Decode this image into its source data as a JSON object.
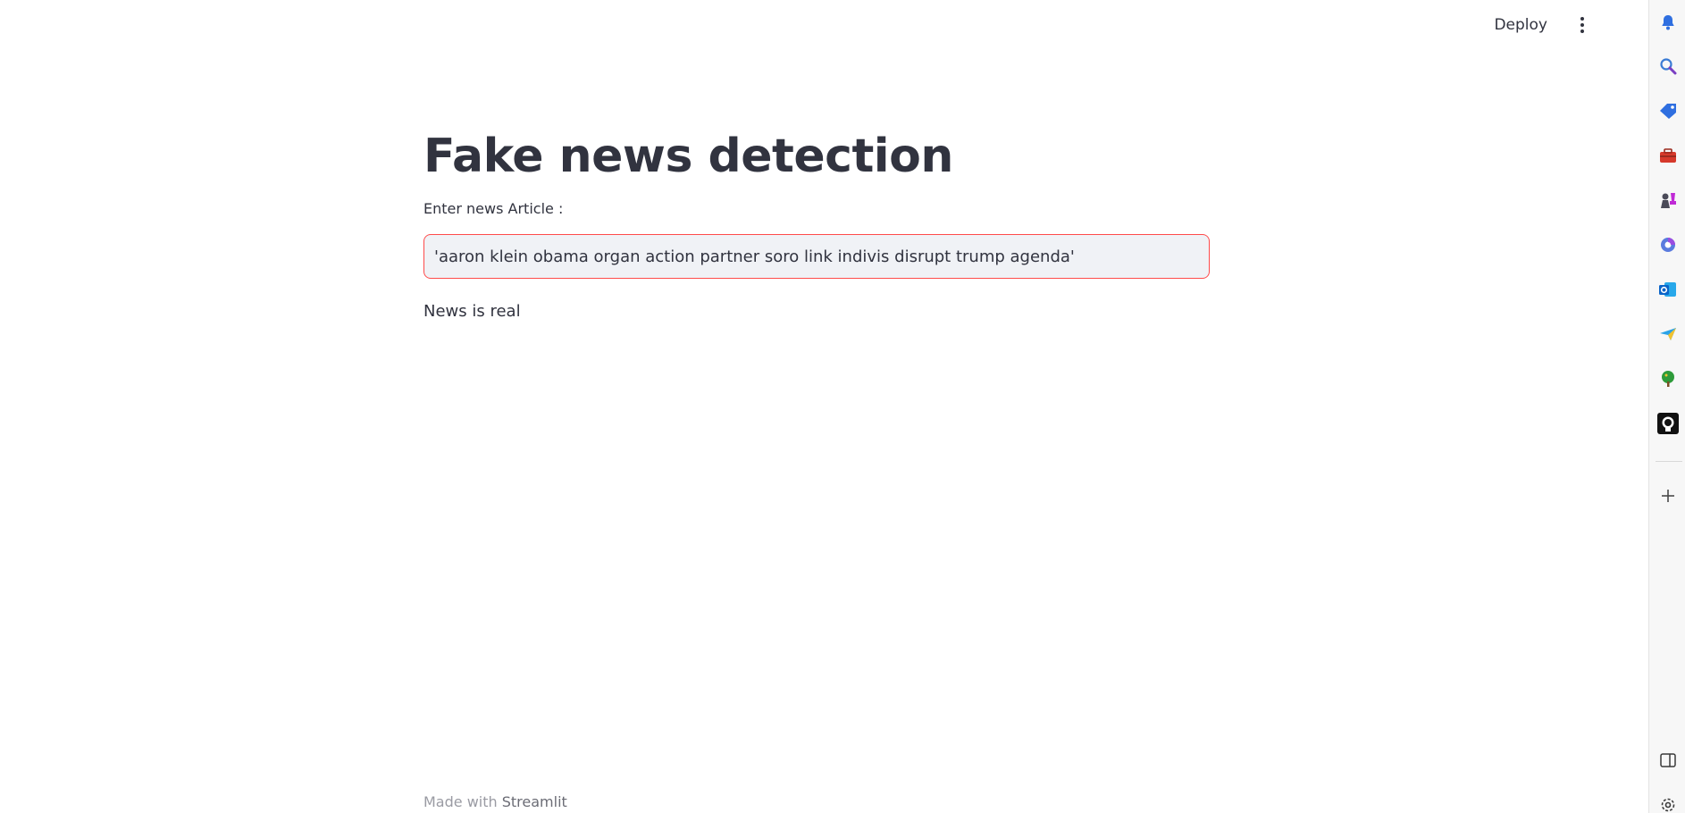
{
  "toolbar": {
    "deploy_label": "Deploy"
  },
  "main": {
    "title": "Fake news detection",
    "input_label": "Enter news Article :",
    "input_value": "'aaron klein obama organ action partner soro link indivis disrupt trump agenda'",
    "result": "News is real"
  },
  "footer": {
    "prefix": "Made with ",
    "link": "Streamlit"
  },
  "sidebar": {
    "icons": [
      "bell-icon",
      "search-icon",
      "tag-icon",
      "toolbox-icon",
      "chess-icon",
      "office-icon",
      "outlook-icon",
      "send-icon",
      "tree-icon",
      "github-icon",
      "add-icon",
      "split-view-icon",
      "settings-icon"
    ]
  },
  "colors": {
    "accent": "#ff4b4b",
    "text": "#31333f",
    "input_bg": "#f0f2f6"
  }
}
